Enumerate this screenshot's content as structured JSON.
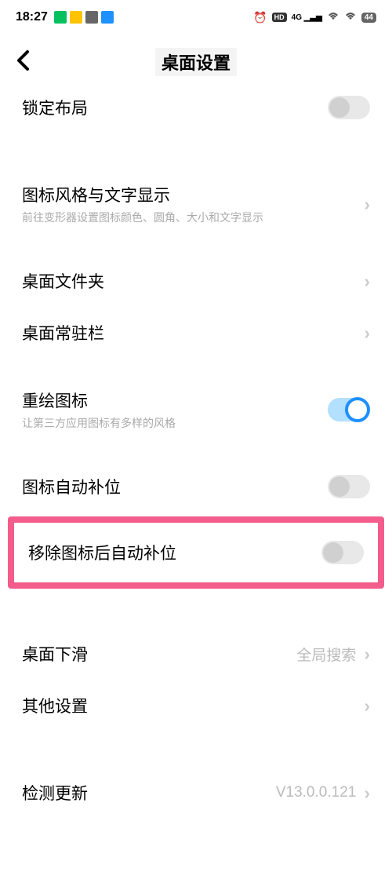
{
  "status": {
    "time": "18:27",
    "network_label": "4G",
    "battery": "44"
  },
  "header": {
    "title": "桌面设置"
  },
  "rows": {
    "lock_layout": {
      "title": "锁定布局"
    },
    "icon_style": {
      "title": "图标风格与文字显示",
      "subtitle": "前往变形器设置图标颜色、圆角、大小和文字显示"
    },
    "desktop_folder": {
      "title": "桌面文件夹"
    },
    "dock_bar": {
      "title": "桌面常驻栏"
    },
    "redraw_icon": {
      "title": "重绘图标",
      "subtitle": "让第三方应用图标有多样的风格"
    },
    "auto_fill": {
      "title": "图标自动补位"
    },
    "remove_auto_fill": {
      "title": "移除图标后自动补位"
    },
    "swipe_down": {
      "title": "桌面下滑",
      "value": "全局搜索"
    },
    "other_settings": {
      "title": "其他设置"
    },
    "check_update": {
      "title": "检测更新",
      "value": "V13.0.0.121"
    }
  }
}
